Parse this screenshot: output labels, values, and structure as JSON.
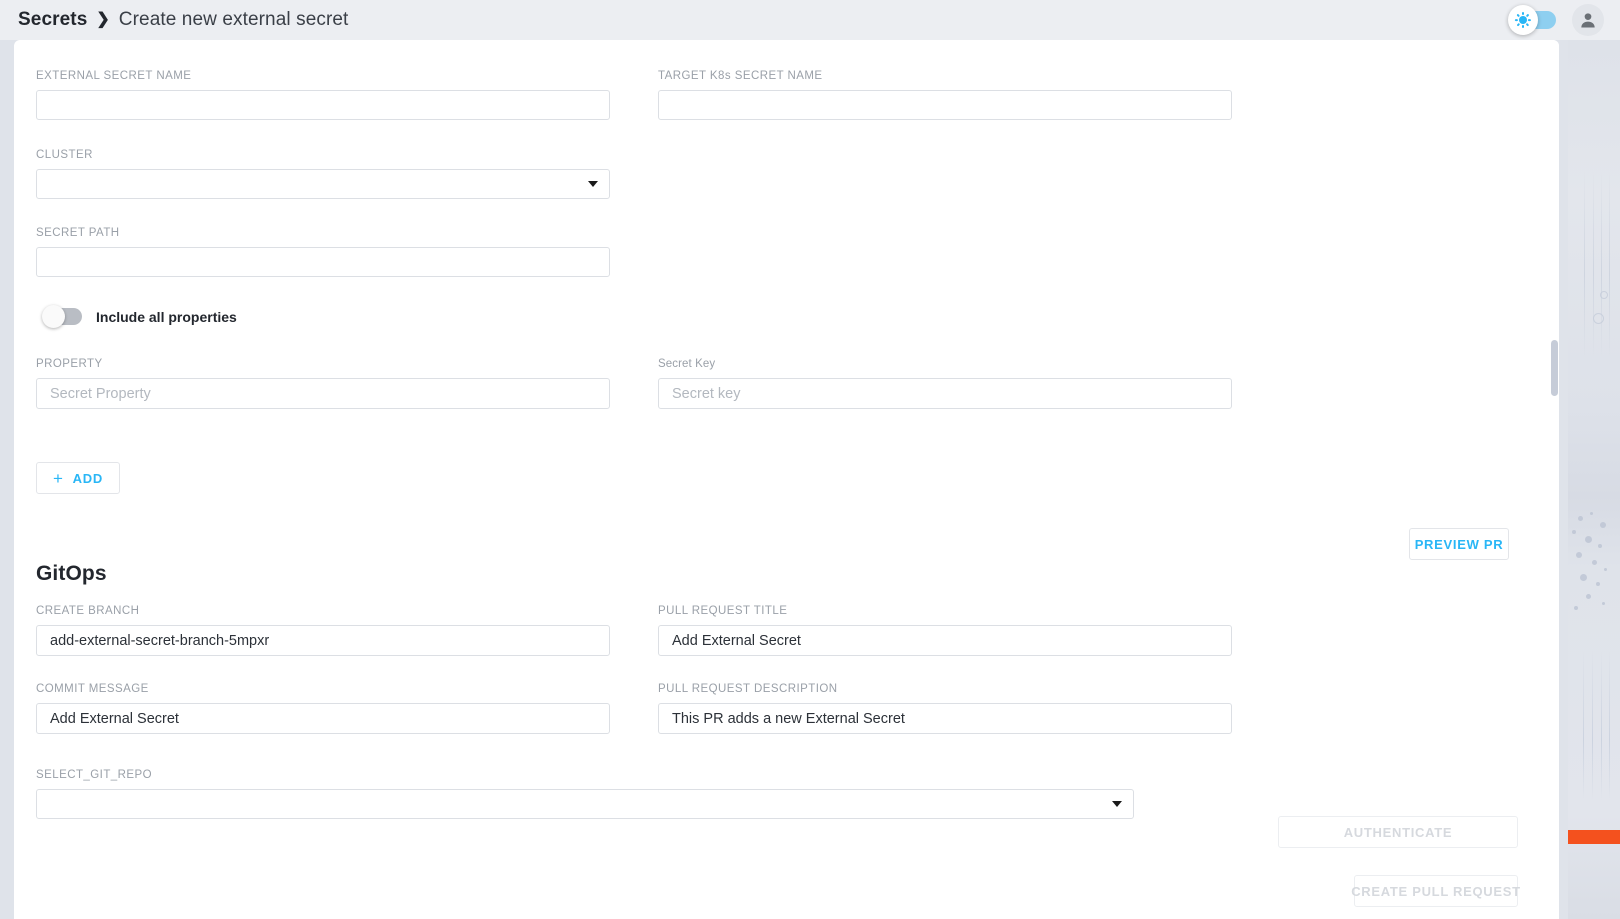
{
  "topbar": {
    "breadcrumb_root": "Secrets",
    "breadcrumb_separator": "❯",
    "breadcrumb_current": "Create new external secret",
    "theme_toggle_icon": "sun-icon",
    "theme_toggle_state": "on",
    "avatar_icon": "user-avatar-icon",
    "accent_color": "#29b6f6",
    "background_color": "#eceef2"
  },
  "form": {
    "external_secret_name": {
      "label": "EXTERNAL SECRET NAME",
      "value": "",
      "placeholder": ""
    },
    "target_k8s_secret_name": {
      "label": "TARGET K8s SECRET NAME",
      "value": "",
      "placeholder": ""
    },
    "cluster": {
      "label": "CLUSTER",
      "value": "",
      "caret_icon": "chevron-down-icon"
    },
    "secret_path": {
      "label": "SECRET PATH",
      "value": "",
      "placeholder": ""
    },
    "include_all_properties": {
      "label": "Include all properties",
      "state": "off"
    },
    "property": {
      "label": "PROPERTY",
      "value": "",
      "placeholder": "Secret Property"
    },
    "secret_key": {
      "label": "Secret Key",
      "value": "",
      "placeholder": "Secret key"
    },
    "add_button": {
      "label": "ADD",
      "icon": "plus-icon"
    },
    "preview_pr_button": {
      "label": "PREVIEW PR"
    }
  },
  "gitops": {
    "title": "GitOps",
    "create_branch": {
      "label": "CREATE BRANCH",
      "value": "add-external-secret-branch-5mpxr"
    },
    "pull_request_title": {
      "label": "PULL REQUEST TITLE",
      "value": "Add External Secret"
    },
    "commit_message": {
      "label": "COMMIT MESSAGE",
      "value": "Add External Secret"
    },
    "pull_request_description": {
      "label": "PULL REQUEST DESCRIPTION",
      "value": "This PR adds a new External Secret"
    },
    "select_git_repo": {
      "label": "SELECT_GIT_REPO",
      "value": "",
      "caret_icon": "chevron-down-icon"
    },
    "authenticate_button": {
      "label": "AUTHENTICATE",
      "state": "disabled"
    },
    "create_pull_request_button": {
      "label": "CREATE PULL REQUEST",
      "state": "disabled"
    }
  }
}
